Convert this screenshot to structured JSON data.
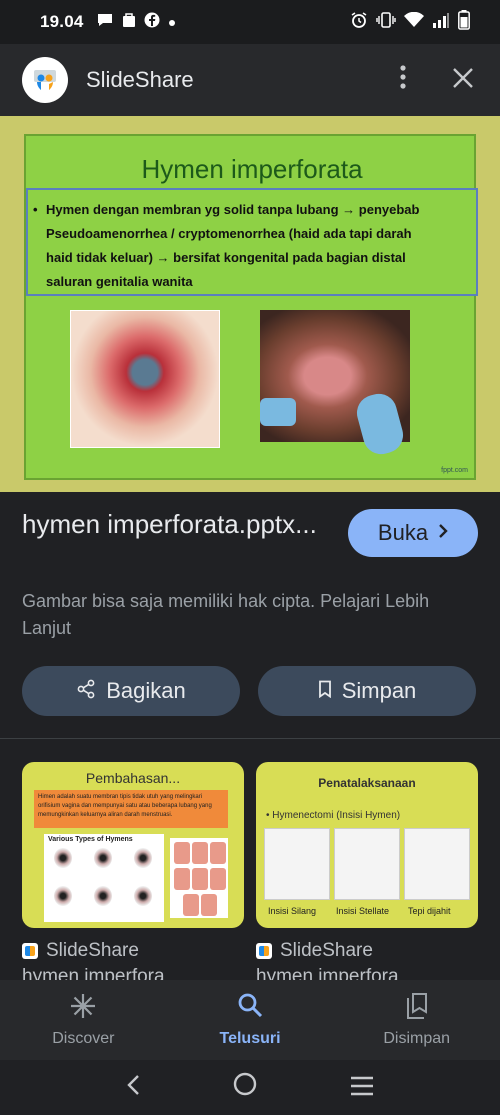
{
  "status_bar": {
    "time": "19.04",
    "notification_icons": [
      "chat-bubble-icon",
      "shop-bag-icon",
      "facebook-icon",
      "dot-icon"
    ],
    "status_icons": [
      "alarm-icon",
      "vibrate-icon",
      "wifi-icon",
      "signal-icon",
      "battery-icon"
    ]
  },
  "app_bar": {
    "title": "SlideShare",
    "more_icon": "more-vert-icon",
    "close_icon": "close-icon"
  },
  "slide": {
    "title": "Hymen imperforata",
    "bullet_lines": [
      "Hymen dengan membran yg solid tanpa lubang → penyebab",
      "Pseudoamenorrhea / cryptomenorrhea (haid ada tapi darah",
      "haid tidak keluar) → bersifat kongenital pada bagian distal",
      "saluran genitalia wanita"
    ],
    "watermark": "fppt.com"
  },
  "result": {
    "title": "hymen imperforata.pptx...",
    "open_button": "Buka",
    "copyright_note": "Gambar bisa saja memiliki hak cipta. Pelajari Lebih Lanjut",
    "share_button": "Bagikan",
    "save_button": "Simpan"
  },
  "related": [
    {
      "slide_title": "Pembahasan...",
      "slide_text": "Himen adalah suatu membran tipis tidak utuh yang melingkari orifisium vagina dan mempunyai satu atau beberapa lubang yang memungkinkan keluarnya aliran darah menstruasi.",
      "diagram_title": "Various Types of Hymens",
      "source": "SlideShare",
      "snippet": "hymen imperfora"
    },
    {
      "slide_title": "Penatalaksanaan",
      "slide_bullet": "Hymenectomi (Insisi Hymen)",
      "captions": [
        "Insisi Silang",
        "Insisi Stellate",
        "Tepi dijahit"
      ],
      "source": "SlideShare",
      "snippet": "hymen imperfora"
    }
  ],
  "bottom_nav": [
    {
      "label": "Discover",
      "icon": "asterisk-icon",
      "active": false
    },
    {
      "label": "Telusuri",
      "icon": "search-icon",
      "active": true
    },
    {
      "label": "Disimpan",
      "icon": "collections-icon",
      "active": false
    }
  ],
  "system_nav": [
    "back-icon",
    "home-icon",
    "recents-icon"
  ]
}
